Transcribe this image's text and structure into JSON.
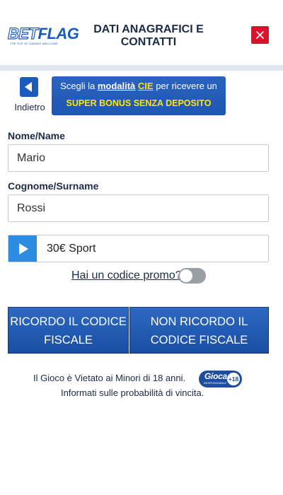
{
  "header": {
    "logo_bet": "BET",
    "logo_flag": "FLAG",
    "logo_tagline": "THE TOP OF GAMING WELCOME",
    "title": "DATI ANAGRAFICI E CONTATTI",
    "close_icon": "close-icon",
    "close_color": "#e0102a"
  },
  "back": {
    "icon": "back-arrow-icon",
    "label": "Indietro"
  },
  "promo_banner": {
    "text_before": "Scegli la ",
    "link": "modalità",
    "highlight": "CIE",
    "text_after": "per ricevere un",
    "headline": "SUPER BONUS SENZA DEPOSITO"
  },
  "form": {
    "name_label": "Nome/Name",
    "name_value": "Mario",
    "surname_label": "Cognome/Surname",
    "surname_value": "Rossi",
    "bonus_icon": "play-icon",
    "bonus_value": "30€ Sport",
    "promo_question": "Hai un codice promo?",
    "promo_toggle_on": false
  },
  "fiscal_code": {
    "remember_label": "RICORDO IL CODICE FISCALE",
    "not_remember_label": "NON RICORDO IL CODICE FISCALE"
  },
  "footer": {
    "line1": "Il Gioco è Vietato ai Minori di 18 anni.",
    "badge_gioca": "Gioca",
    "badge_responsabile": "RESPONSABILE",
    "badge_age": "+18",
    "line2": "Informati sulle probabilità di vincita."
  },
  "colors": {
    "brand_blue": "#1b5bbf",
    "close_red": "#e0102a",
    "promo_yellow": "#ffe600",
    "toggle_off": "#9a9fa6"
  }
}
